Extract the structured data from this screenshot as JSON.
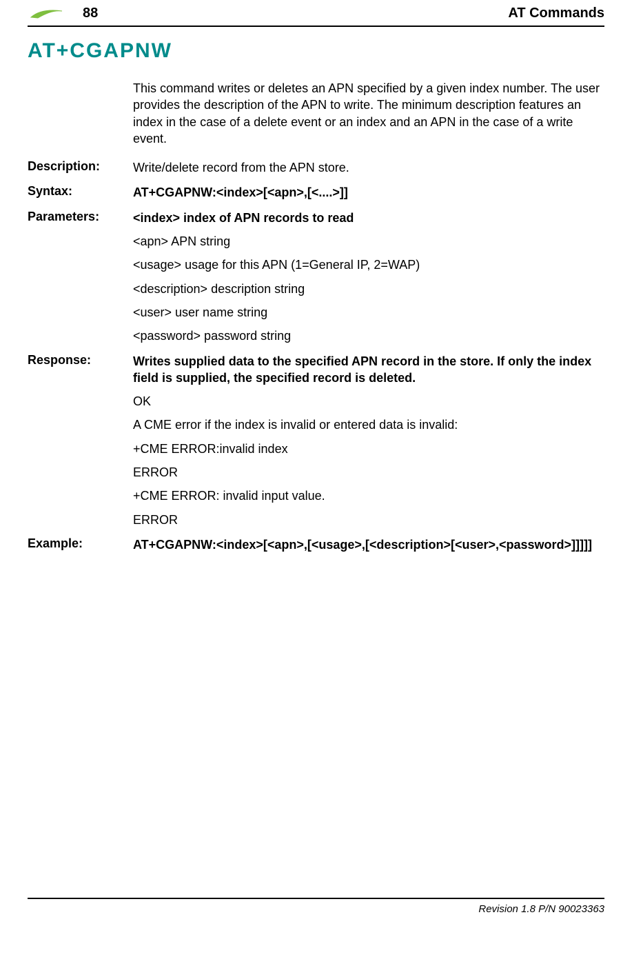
{
  "header": {
    "page_number": "88",
    "chapter": "AT Commands"
  },
  "command_title": "AT+CGAPNW",
  "intro": "This command writes or deletes an APN specified by a given index number. The user provides the description of the APN to write. The minimum description features an index in the case of a delete event or an index and an APN in the case of a write event.",
  "entries": {
    "description": {
      "label": "Description:",
      "text": "Write/delete record from the APN store."
    },
    "syntax": {
      "label": "Syntax:",
      "text": "AT+CGAPNW:<index>[<apn>,[<....>]]"
    },
    "parameters": {
      "label": "Parameters:",
      "heading": "<index> index of APN records to read",
      "lines": [
        "<apn> APN string",
        "<usage> usage for this APN (1=General IP, 2=WAP)",
        "<description> description string",
        "<user> user name string",
        "<password> password string"
      ]
    },
    "response": {
      "label": "Response:",
      "heading": "Writes supplied data to the specified APN record in the store. If only the index field is supplied, the specified record is deleted.",
      "lines": [
        "OK",
        "A CME error if the index is invalid or entered data is invalid:",
        "+CME ERROR:invalid index",
        "ERROR",
        "+CME ERROR: invalid input value.",
        "ERROR"
      ]
    },
    "example": {
      "label": "Example:",
      "text": "AT+CGAPNW:<index>[<apn>,[<usage>,[<description>[<user>,<password>]]]]]"
    }
  },
  "footer": {
    "text": "Revision 1.8  P/N 90023363"
  }
}
